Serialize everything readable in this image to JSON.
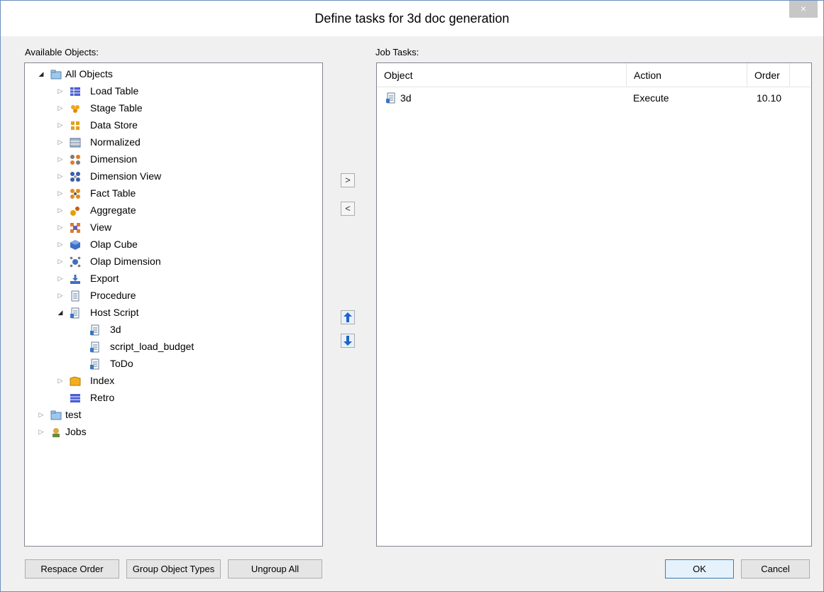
{
  "dialog": {
    "title": "Define tasks for 3d doc generation",
    "close_symbol": "×"
  },
  "available_objects": {
    "label": "Available Objects:",
    "tree": [
      {
        "label": "All Objects",
        "icon": "folder-icon",
        "expander": "open",
        "level": 0
      },
      {
        "label": "Load Table",
        "icon": "load-table-icon",
        "expander": "closed",
        "level": 1
      },
      {
        "label": "Stage Table",
        "icon": "stage-table-icon",
        "expander": "closed",
        "level": 1
      },
      {
        "label": "Data Store",
        "icon": "data-store-icon",
        "expander": "closed",
        "level": 1
      },
      {
        "label": "Normalized",
        "icon": "normalized-icon",
        "expander": "closed",
        "level": 1
      },
      {
        "label": "Dimension",
        "icon": "dimension-icon",
        "expander": "closed",
        "level": 1
      },
      {
        "label": "Dimension View",
        "icon": "dimension-view-icon",
        "expander": "closed",
        "level": 1
      },
      {
        "label": "Fact Table",
        "icon": "fact-table-icon",
        "expander": "closed",
        "level": 1
      },
      {
        "label": "Aggregate",
        "icon": "aggregate-icon",
        "expander": "closed",
        "level": 1
      },
      {
        "label": "View",
        "icon": "view-icon",
        "expander": "closed",
        "level": 1
      },
      {
        "label": "Olap Cube",
        "icon": "olap-cube-icon",
        "expander": "closed",
        "level": 1
      },
      {
        "label": "Olap Dimension",
        "icon": "olap-dimension-icon",
        "expander": "closed",
        "level": 1
      },
      {
        "label": "Export",
        "icon": "export-icon",
        "expander": "closed",
        "level": 1
      },
      {
        "label": "Procedure",
        "icon": "procedure-icon",
        "expander": "closed",
        "level": 1
      },
      {
        "label": "Host Script",
        "icon": "script-icon",
        "expander": "open",
        "level": 1
      },
      {
        "label": "3d",
        "icon": "script-icon",
        "expander": "none",
        "level": 2
      },
      {
        "label": "script_load_budget",
        "icon": "script-icon",
        "expander": "none",
        "level": 2
      },
      {
        "label": "ToDo",
        "icon": "script-icon",
        "expander": "none",
        "level": 2
      },
      {
        "label": "Index",
        "icon": "index-icon",
        "expander": "closed",
        "level": 1
      },
      {
        "label": "Retro",
        "icon": "retro-icon",
        "expander": "none",
        "level": 1
      },
      {
        "label": "test",
        "icon": "folder-icon",
        "expander": "closed",
        "level": 0
      },
      {
        "label": "Jobs",
        "icon": "jobs-icon",
        "expander": "closed",
        "level": 0
      }
    ]
  },
  "job_tasks": {
    "label": "Job Tasks:",
    "columns": [
      "Object",
      "Action",
      "Order"
    ],
    "rows": [
      {
        "object": "3d",
        "action": "Execute",
        "order": "10.10",
        "icon": "script-icon"
      }
    ]
  },
  "middle": {
    "add_label": ">",
    "remove_label": "<"
  },
  "buttons": {
    "respace": "Respace Order",
    "group": "Group Object Types",
    "ungroup": "Ungroup All",
    "ok": "OK",
    "cancel": "Cancel"
  }
}
